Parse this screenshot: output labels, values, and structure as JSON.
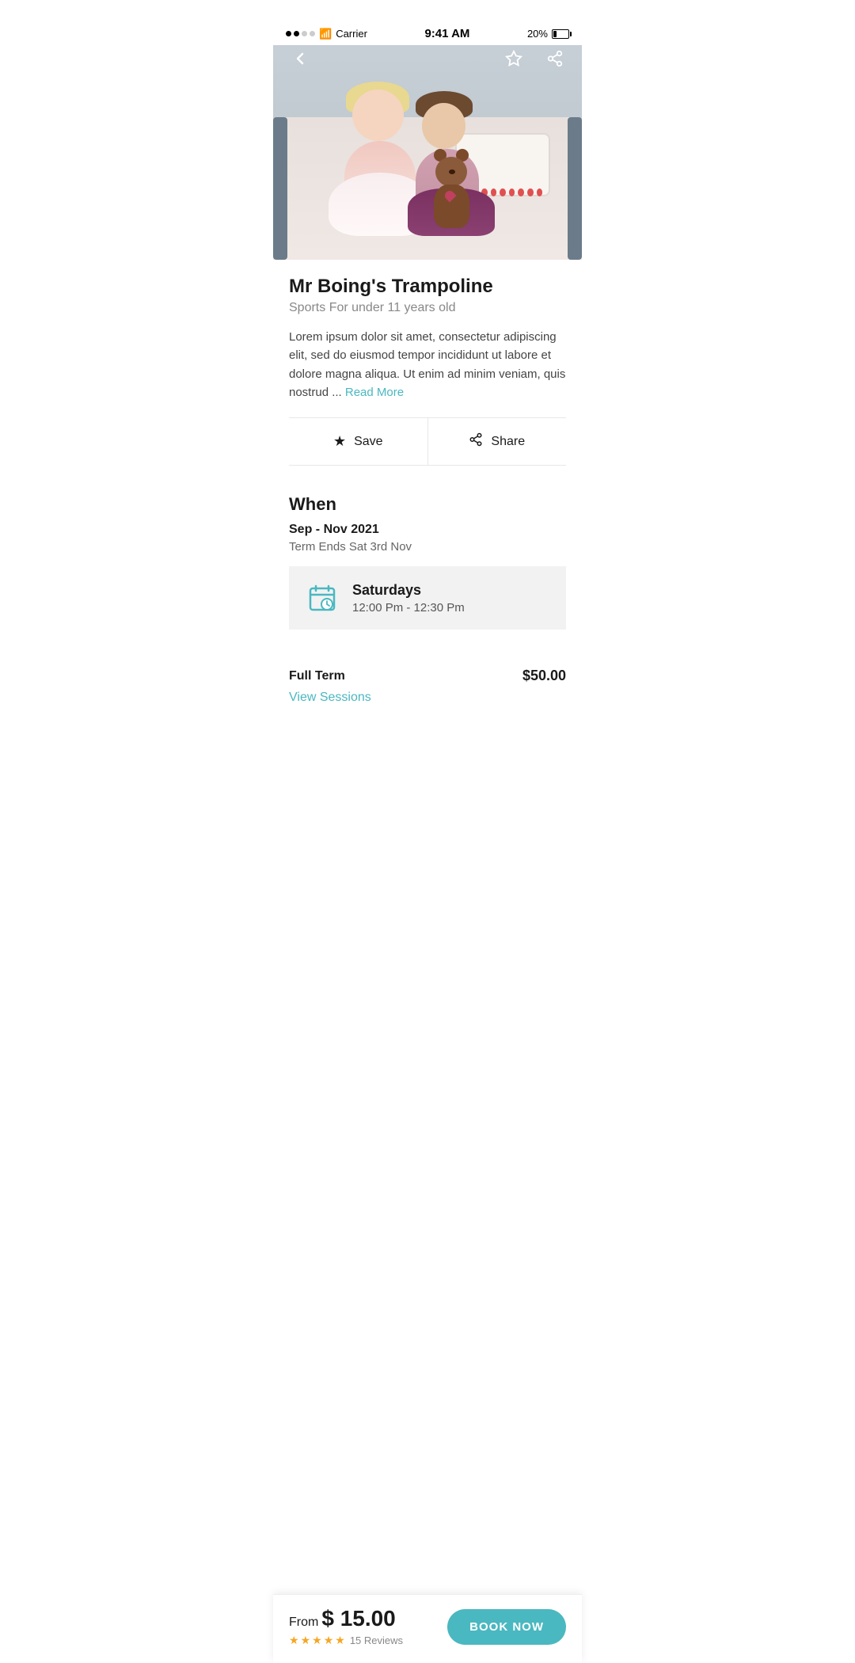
{
  "statusBar": {
    "carrier": "Carrier",
    "time": "9:41 AM",
    "battery": "20%"
  },
  "nav": {
    "backIcon": "‹",
    "saveIcon": "★",
    "shareIcon": "⤴"
  },
  "hero": {
    "altText": "Two children sitting on a bed with fairy lights"
  },
  "content": {
    "title": "Mr Boing's Trampoline",
    "subtitle": "Sports For under 11 years old",
    "description": "Lorem ipsum dolor sit amet, consectetur adipiscing elit, sed do eiusmod tempor incididunt ut labore et dolore magna aliqua. Ut enim ad minim veniam, quis nostrud ...",
    "readMore": "Read More"
  },
  "actions": {
    "save": "Save",
    "share": "Share"
  },
  "when": {
    "heading": "When",
    "dateRange": "Sep - Nov 2021",
    "termEnd": "Term Ends Sat 3rd Nov",
    "schedule": {
      "day": "Saturdays",
      "time": "12:00 Pm - 12:30 Pm"
    }
  },
  "pricing": {
    "label": "Full Term",
    "price": "$50.00",
    "viewSessions": "View Sessions"
  },
  "bottomBar": {
    "fromLabel": "From",
    "currencySymbol": "$",
    "price": "15.00",
    "stars": [
      1,
      2,
      3,
      4,
      5
    ],
    "reviewCount": "15 Reviews",
    "bookButton": "BOOK NOW"
  }
}
